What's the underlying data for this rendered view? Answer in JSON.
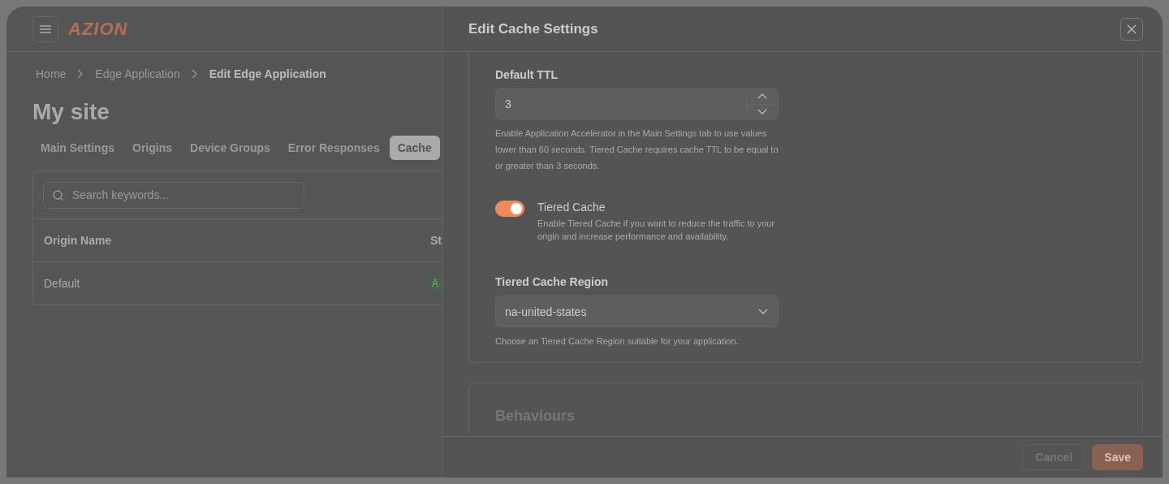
{
  "header": {
    "logo": "AZION"
  },
  "breadcrumb": [
    {
      "label": "Home",
      "current": false
    },
    {
      "label": "Edge Application",
      "current": false
    },
    {
      "label": "Edit Edge Application",
      "current": true
    }
  ],
  "page_title": "My site",
  "tabs": [
    {
      "label": "Main Settings",
      "selected": false
    },
    {
      "label": "Origins",
      "selected": false
    },
    {
      "label": "Device Groups",
      "selected": false
    },
    {
      "label": "Error Responses",
      "selected": false
    },
    {
      "label": "Cache",
      "selected": true
    }
  ],
  "search": {
    "placeholder": "Search keywords..."
  },
  "table": {
    "columns": [
      "Origin Name",
      "St"
    ],
    "rows": [
      {
        "name": "Default",
        "status": "A"
      }
    ]
  },
  "drawer": {
    "title": "Edit Cache Settings",
    "default_ttl": {
      "label": "Default TTL",
      "value": "3",
      "help": "Enable Application Accelerator in the Main Settings tab to use values lower than 60 seconds. Tiered Cache requires cache TTL to be equal to or greater than 3 seconds."
    },
    "tiered_cache": {
      "label": "Tiered Cache",
      "on": true,
      "help": "Enable Tiered Cache if you want to reduce the traffic to your origin and increase performance and availability."
    },
    "region": {
      "label": "Tiered Cache Region",
      "value": "na-united-states",
      "help": "Choose an Tiered Cache Region suitable for your application."
    },
    "next_section": "Behaviours",
    "buttons": [
      {
        "label": "Cancel",
        "kind": "secondary"
      },
      {
        "label": "Save",
        "kind": "primary"
      }
    ]
  }
}
